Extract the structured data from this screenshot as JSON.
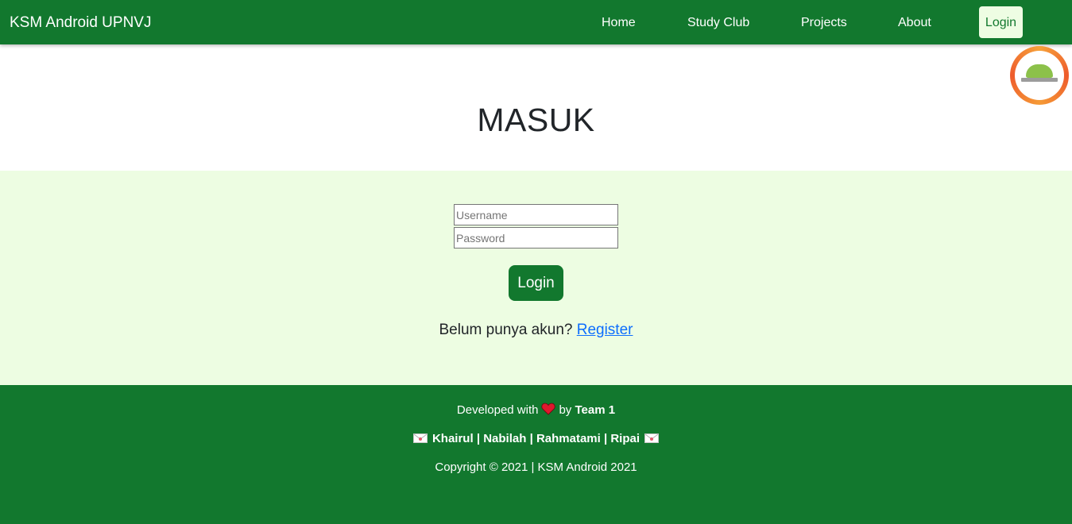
{
  "navbar": {
    "brand": "KSM Android UPNVJ",
    "links": [
      "Home",
      "Study Club",
      "Projects",
      "About"
    ],
    "login": "Login"
  },
  "colors": {
    "primary": "#12782e",
    "form_bg": "#edfde2",
    "link": "#0d6efd"
  },
  "logo": {
    "icon": "ksm-android-logo"
  },
  "page": {
    "title": "MASUK"
  },
  "form": {
    "username_placeholder": "Username",
    "password_placeholder": "Password",
    "submit": "Login",
    "prompt": "Belum punya akun?",
    "register": "Register"
  },
  "footer": {
    "dev_prefix": "Developed with",
    "dev_by": "by",
    "team": "Team 1",
    "members": [
      "Khairul",
      "Nabilah",
      "Rahmatami",
      "Ripai"
    ],
    "separator": "|",
    "copyright": "Copyright © 2021 | KSM Android 2021"
  }
}
